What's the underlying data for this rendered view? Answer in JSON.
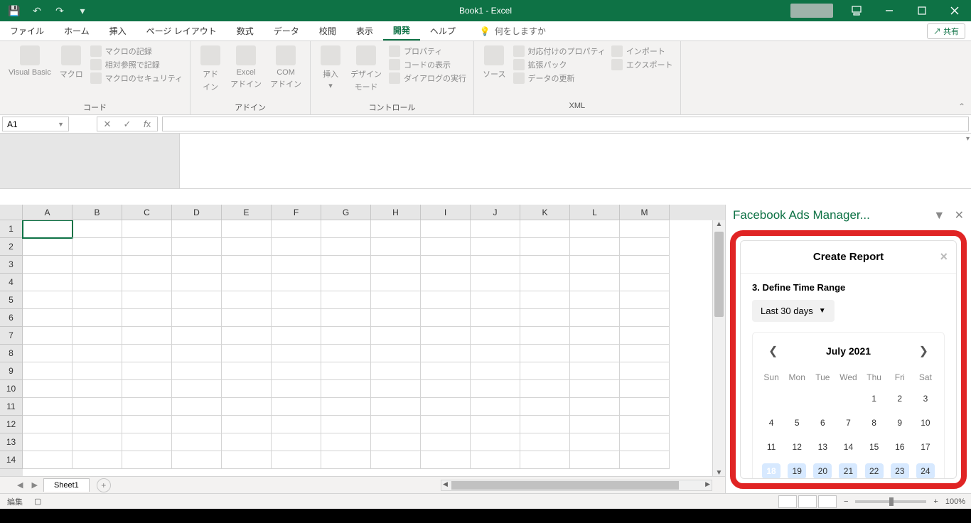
{
  "titlebar": {
    "title": "Book1  -  Excel"
  },
  "menu": {
    "tabs": [
      "ファイル",
      "ホーム",
      "挿入",
      "ページ レイアウト",
      "数式",
      "データ",
      "校閲",
      "表示",
      "開発",
      "ヘルプ"
    ],
    "tell": "何をしますか",
    "active_index": 8,
    "share": "共有"
  },
  "ribbon": {
    "groups": [
      {
        "label": "コード",
        "big": [
          {
            "l1": "Visual Basic"
          },
          {
            "l1": "マクロ"
          }
        ],
        "small": [
          "マクロの記録",
          "相対参照で記録",
          "マクロのセキュリティ"
        ]
      },
      {
        "label": "アドイン",
        "big": [
          {
            "l1": "アド",
            "l2": "イン"
          },
          {
            "l1": "Excel",
            "l2": "アドイン"
          },
          {
            "l1": "COM",
            "l2": "アドイン"
          }
        ],
        "small": []
      },
      {
        "label": "コントロール",
        "big": [
          {
            "l1": "挿入",
            "l2": "▾"
          },
          {
            "l1": "デザイン",
            "l2": "モード"
          }
        ],
        "small": [
          "プロパティ",
          "コードの表示",
          "ダイアログの実行"
        ]
      },
      {
        "label": "XML",
        "big": [
          {
            "l1": "ソース"
          }
        ],
        "small_l": [
          "対応付けのプロパティ",
          "拡張パック",
          "データの更新"
        ],
        "small_r": [
          "インポート",
          "エクスポート"
        ]
      }
    ]
  },
  "namebox": "A1",
  "grid": {
    "cols": [
      "A",
      "B",
      "C",
      "D",
      "E",
      "F",
      "G",
      "H",
      "I",
      "J",
      "K",
      "L",
      "M"
    ],
    "row_count": 14,
    "selected": {
      "row": 0,
      "col": 0
    }
  },
  "sheet": {
    "name": "Sheet1"
  },
  "status": {
    "mode": "編集",
    "zoom": "100%"
  },
  "taskpane": {
    "title": "Facebook Ads Manager...",
    "panel_title": "Create Report",
    "section": "3. Define Time Range",
    "range_label": "Last 30 days",
    "calendar": {
      "month": "July 2021",
      "dow": [
        "Sun",
        "Mon",
        "Tue",
        "Wed",
        "Thu",
        "Fri",
        "Sat"
      ],
      "weeks": [
        [
          "",
          "",
          "",
          "",
          "1",
          "2",
          "3"
        ],
        [
          "4",
          "5",
          "6",
          "7",
          "8",
          "9",
          "10"
        ],
        [
          "11",
          "12",
          "13",
          "14",
          "15",
          "16",
          "17"
        ],
        [
          "18",
          "19",
          "20",
          "21",
          "22",
          "23",
          "24"
        ]
      ],
      "highlight_row": 3,
      "selected_day": "18"
    }
  },
  "chart_data": {
    "type": "table",
    "note": "no chart in image"
  }
}
